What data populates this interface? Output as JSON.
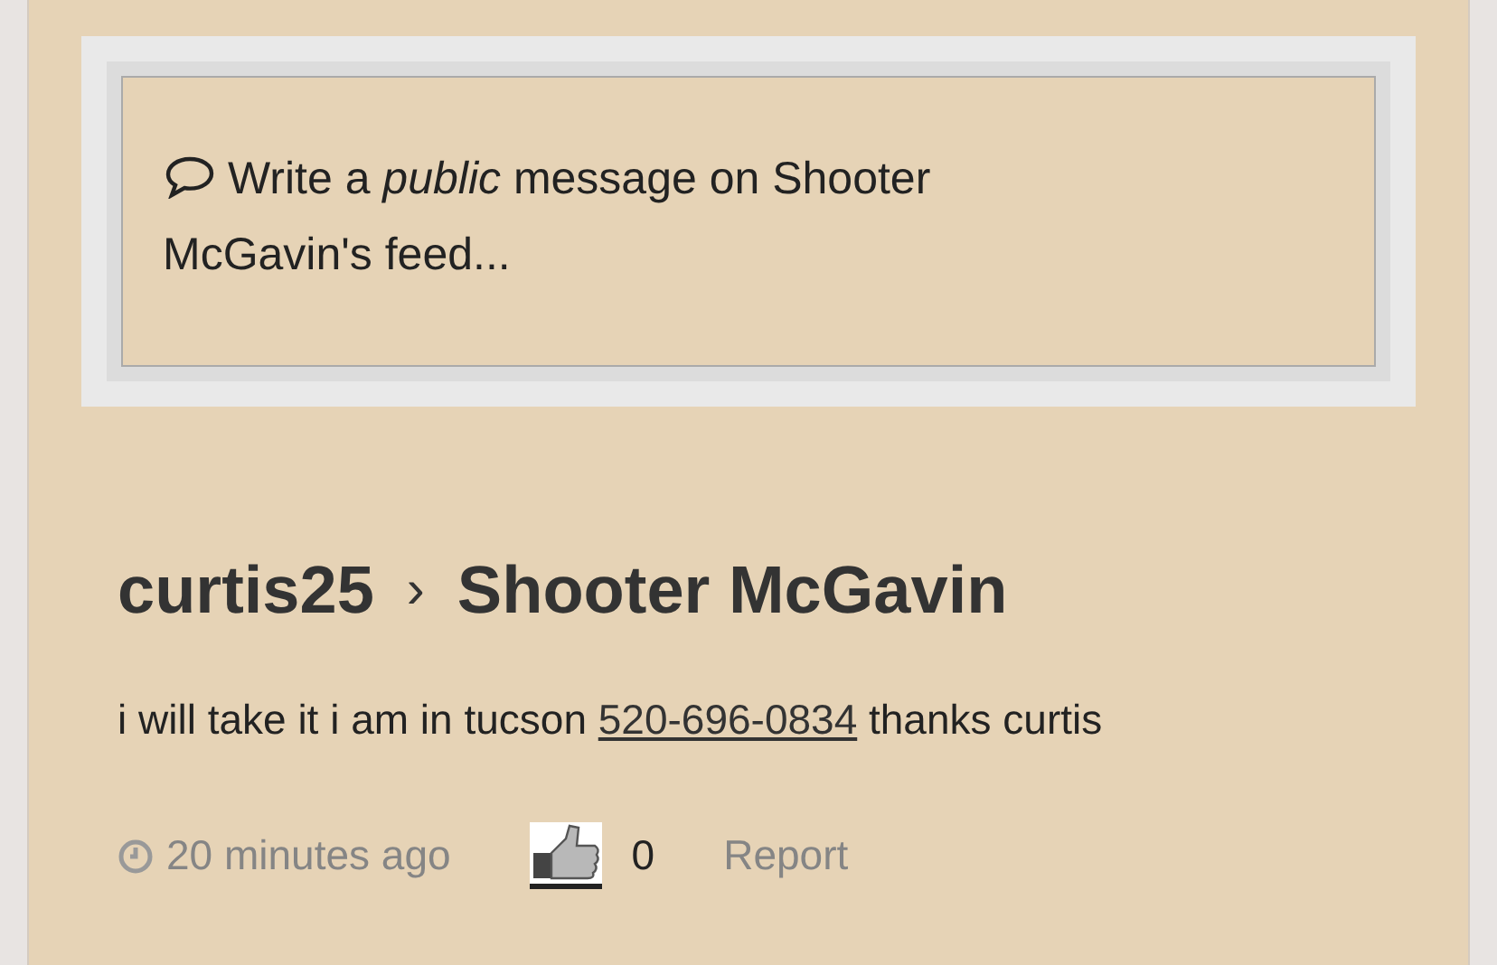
{
  "composer": {
    "placeholder": "Write a *public* message on Shooter McGavin's feed..."
  },
  "post": {
    "author": "curtis25",
    "separator": "›",
    "recipient": "Shooter McGavin",
    "message": {
      "before": "i will take it i am in tucson",
      "phone": "520-696-0834",
      "after": "thanks curtis"
    },
    "time": "20 minutes ago",
    "like_count": "0",
    "report": "Report"
  }
}
